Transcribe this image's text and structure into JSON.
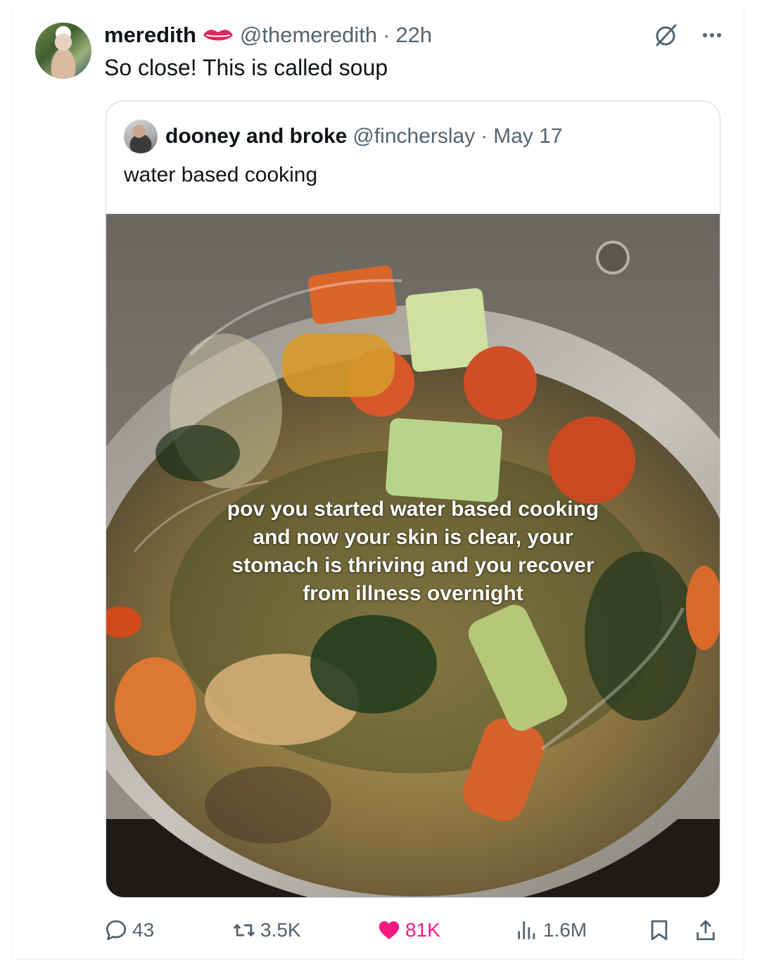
{
  "tweet": {
    "author_name": "meredith",
    "handle": "@themeredith",
    "separator": "·",
    "time": "22h",
    "text": "So close! This is called soup"
  },
  "quoted": {
    "author_name": "dooney and broke",
    "handle": "@fincherslay",
    "separator": "·",
    "date": "May 17",
    "text": "water based cooking",
    "media_overlay_lines": [
      "pov you started water based cooking",
      "and now your skin is clear, your",
      "stomach is thriving and you recover",
      "from illness overnight"
    ]
  },
  "actions": {
    "replies": "43",
    "reposts": "3.5K",
    "likes": "81K",
    "views": "1.6M"
  },
  "icons": {
    "top_right": [
      "grok-icon",
      "more-icon"
    ],
    "verified_badge": "lips-icon",
    "action_bar": [
      "reply-icon",
      "repost-icon",
      "heart-icon",
      "views-icon",
      "bookmark-icon",
      "share-icon"
    ]
  },
  "colors": {
    "text_primary": "#0f1419",
    "text_secondary": "#536471",
    "like_pink": "#f91880",
    "border": "#cfd9de",
    "lips_red": "#e0245e"
  }
}
